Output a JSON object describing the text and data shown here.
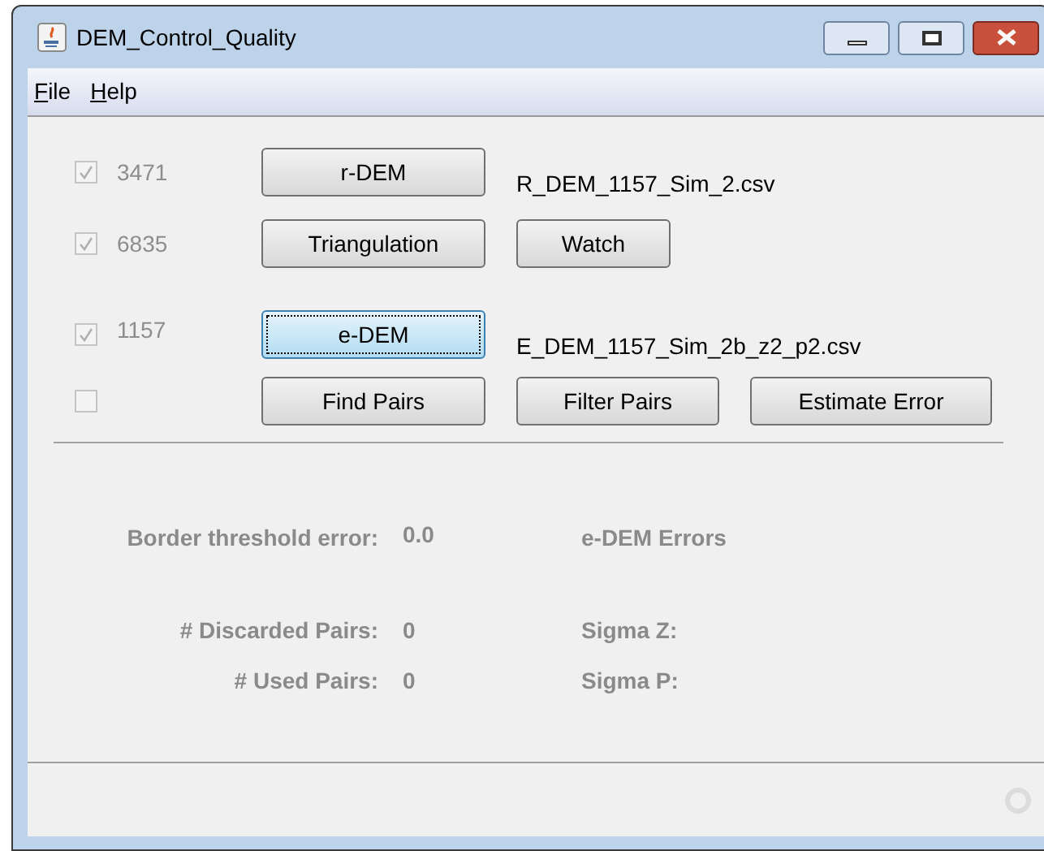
{
  "window": {
    "title": "DEM_Control_Quality"
  },
  "menu": [
    "File",
    "Help"
  ],
  "rows": [
    {
      "checkbox": {
        "checked": true,
        "disabled": true
      },
      "count": "3471",
      "buttons": [
        {
          "label": "r-DEM",
          "focused": false
        }
      ],
      "file": "R_DEM_1157_Sim_2.csv"
    },
    {
      "checkbox": {
        "checked": true,
        "disabled": true
      },
      "count": "6835",
      "buttons": [
        {
          "label": "Triangulation",
          "focused": false
        },
        {
          "label": "Watch",
          "focused": false
        }
      ]
    },
    {
      "checkbox": {
        "checked": true,
        "disabled": true
      },
      "count": "1157",
      "buttons": [
        {
          "label": "e-DEM",
          "focused": true
        }
      ],
      "file": "E_DEM_1157_Sim_2b_z2_p2.csv"
    },
    {
      "checkbox": {
        "checked": false,
        "disabled": true
      },
      "buttons": [
        {
          "label": "Find Pairs",
          "focused": false
        },
        {
          "label": "Filter Pairs",
          "focused": false
        },
        {
          "label": "Estimate Error",
          "focused": false
        }
      ]
    }
  ],
  "stats": [
    {
      "label": "Border threshold error:",
      "value": "0.0",
      "right": "e-DEM Errors"
    },
    {
      "label": "# Discarded Pairs:",
      "value": "0",
      "right": "Sigma Z:"
    },
    {
      "label": "# Used Pairs:",
      "value": "0",
      "right": "Sigma P:"
    }
  ]
}
